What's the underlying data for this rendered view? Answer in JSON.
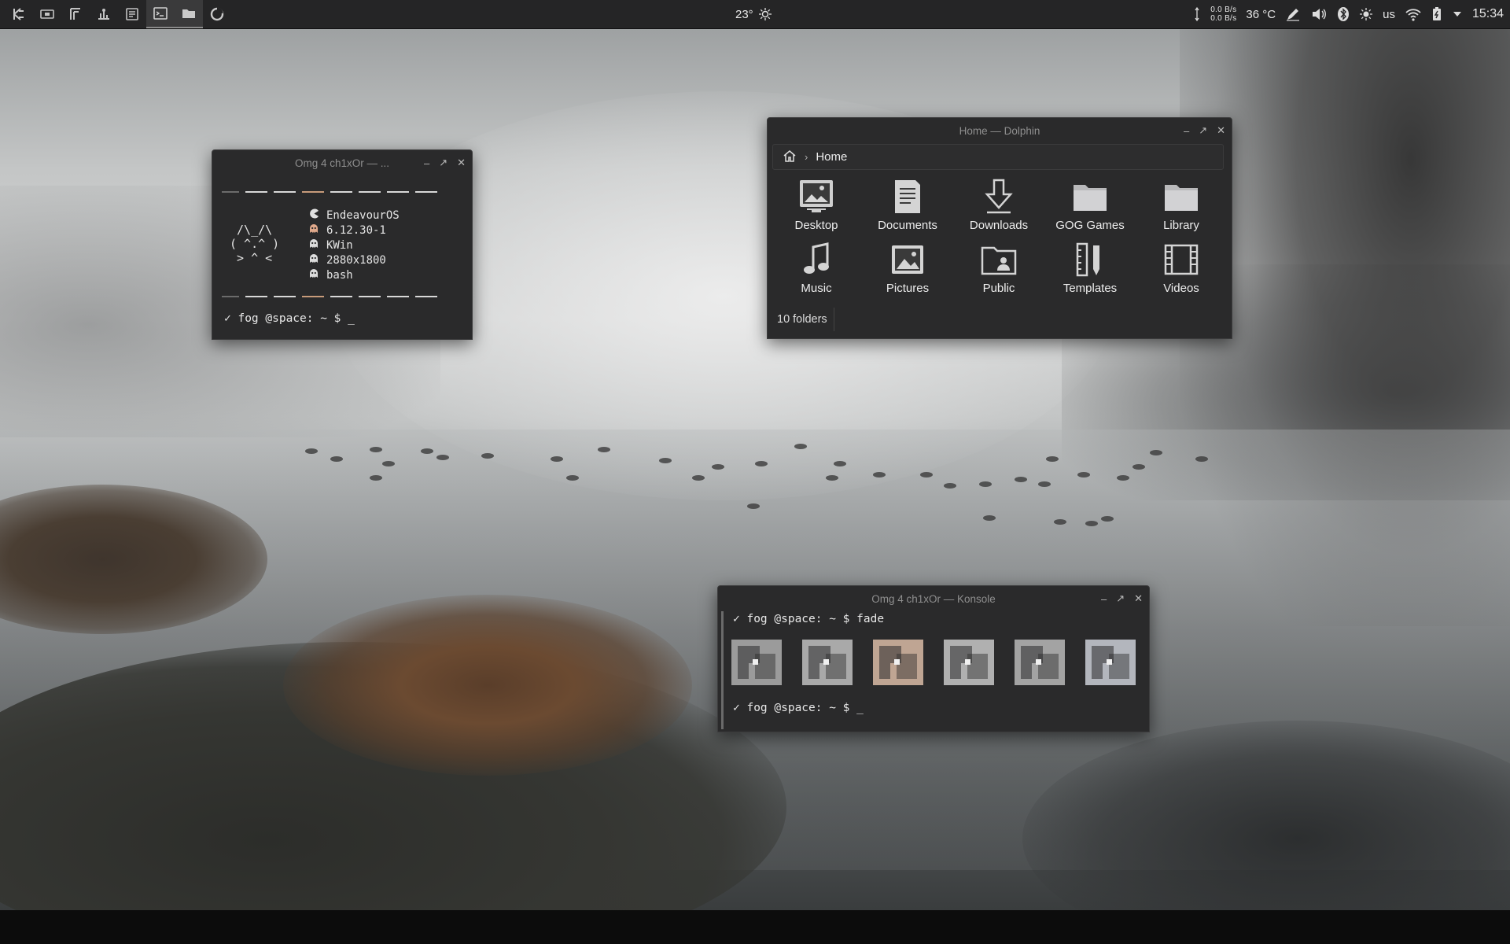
{
  "panel": {
    "launchers": [
      {
        "name": "kde-menu-icon"
      },
      {
        "name": "screen-icon"
      },
      {
        "name": "text-editor-icon"
      },
      {
        "name": "system-settings-icon"
      },
      {
        "name": "notes-icon"
      },
      {
        "name": "terminal-icon",
        "active": true
      },
      {
        "name": "folder-icon",
        "active": true
      },
      {
        "name": "firefox-icon"
      }
    ],
    "weather": {
      "temp": "23°",
      "icon": "sun-icon"
    },
    "tray": {
      "net_up": "0.0 B/s",
      "net_down": "0.0 B/s",
      "cpu_temp": "36 °C",
      "keyboard_layout": "us",
      "clock": "15:34"
    }
  },
  "term1": {
    "title": "Omg 4 ch1xOr — ...",
    "ascii_cat": " /\\_/\\\n( ^.^ )\n > ^ <",
    "info": [
      {
        "icon": "pacman-icon",
        "value": "EndeavourOS"
      },
      {
        "icon": "ghost-icon",
        "value": "6.12.30-1",
        "accent": true
      },
      {
        "icon": "ghost-icon",
        "value": "KWin"
      },
      {
        "icon": "ghost-icon",
        "value": "2880x1800"
      },
      {
        "icon": "ghost-icon",
        "value": "bash"
      }
    ],
    "prompt": "✓ fog @space: ~ $ _"
  },
  "dolphin": {
    "title": "Home — Dolphin",
    "location": "Home",
    "folders": [
      {
        "label": "Desktop",
        "icon": "desktop-folder-icon"
      },
      {
        "label": "Documents",
        "icon": "documents-folder-icon"
      },
      {
        "label": "Downloads",
        "icon": "downloads-folder-icon"
      },
      {
        "label": "GOG Games",
        "icon": "folder-icon"
      },
      {
        "label": "Library",
        "icon": "folder-icon"
      },
      {
        "label": "Music",
        "icon": "music-folder-icon"
      },
      {
        "label": "Pictures",
        "icon": "pictures-folder-icon"
      },
      {
        "label": "Public",
        "icon": "public-folder-icon"
      },
      {
        "label": "Templates",
        "icon": "templates-folder-icon"
      },
      {
        "label": "Videos",
        "icon": "videos-folder-icon"
      }
    ],
    "status": "10 folders"
  },
  "konsole": {
    "title": "Omg 4 ch1xOr — Konsole",
    "prompt1": "✓ fog @space: ~ $ fade",
    "prompt2": "✓ fog @space: ~ $ _",
    "swatch_colors": [
      "#9b9b9b",
      "#a9a9a9",
      "#bfa593",
      "#b0b0b0",
      "#a3a3a3",
      "#b3b6bd"
    ]
  },
  "colors": {
    "accent": "#c79b7a",
    "panel": "#252526",
    "window": "#2a2a2b"
  }
}
